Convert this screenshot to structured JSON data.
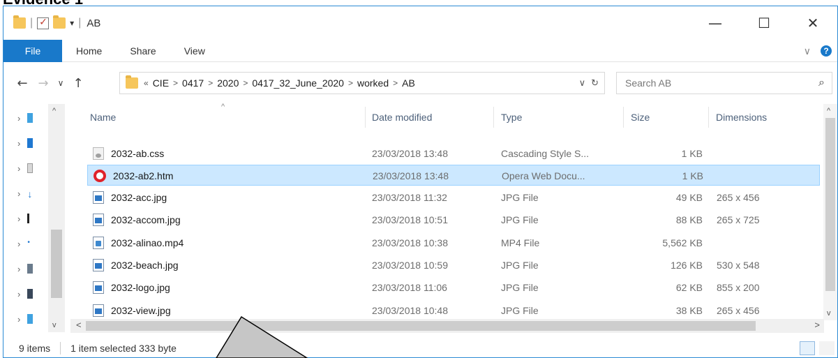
{
  "evidence_label": "Evidence 1",
  "window": {
    "title": "AB",
    "controls": {
      "minimize": "—",
      "maximize": "☐",
      "close": "✕"
    }
  },
  "ribbon": {
    "tabs": [
      {
        "label": "File",
        "active": true
      },
      {
        "label": "Home"
      },
      {
        "label": "Share"
      },
      {
        "label": "View"
      }
    ]
  },
  "address": {
    "prefix": "«",
    "crumbs": [
      "CIE",
      "0417",
      "2020",
      "0417_32_June_2020",
      "worked",
      "AB"
    ],
    "separator": ">",
    "refresh": "↻",
    "dropdown": "∨"
  },
  "search": {
    "placeholder": "Search AB"
  },
  "columns": {
    "name": "Name",
    "date": "Date modified",
    "type": "Type",
    "size": "Size",
    "dimensions": "Dimensions"
  },
  "files": [
    {
      "name": "2032-ab.css",
      "date": "23/03/2018 13:48",
      "type": "Cascading Style S...",
      "size": "1 KB",
      "dimensions": "",
      "icon": "css"
    },
    {
      "name": "2032-ab2.htm",
      "date": "23/03/2018 13:48",
      "type": "Opera Web Docu...",
      "size": "1 KB",
      "dimensions": "",
      "icon": "opera",
      "selected": true
    },
    {
      "name": "2032-acc.jpg",
      "date": "23/03/2018 11:32",
      "type": "JPG File",
      "size": "49 KB",
      "dimensions": "265 x 456",
      "icon": "jpg"
    },
    {
      "name": "2032-accom.jpg",
      "date": "23/03/2018 10:51",
      "type": "JPG File",
      "size": "88 KB",
      "dimensions": "265 x 725",
      "icon": "jpg"
    },
    {
      "name": "2032-alinao.mp4",
      "date": "23/03/2018 10:38",
      "type": "MP4 File",
      "size": "5,562 KB",
      "dimensions": "",
      "icon": "mp4"
    },
    {
      "name": "2032-beach.jpg",
      "date": "23/03/2018 10:59",
      "type": "JPG File",
      "size": "126 KB",
      "dimensions": "530 x 548",
      "icon": "jpg"
    },
    {
      "name": "2032-logo.jpg",
      "date": "23/03/2018 11:06",
      "type": "JPG File",
      "size": "62 KB",
      "dimensions": "855 x 200",
      "icon": "jpg"
    },
    {
      "name": "2032-view.jpg",
      "date": "23/03/2018 10:48",
      "type": "JPG File",
      "size": "38 KB",
      "dimensions": "265 x 456",
      "icon": "jpg"
    }
  ],
  "status": {
    "items": "9 items",
    "selection": "1 item selected  333 byte"
  },
  "colors": {
    "accent": "#1979ca",
    "selection": "#cce8ff",
    "border": "#2a8ad4"
  }
}
